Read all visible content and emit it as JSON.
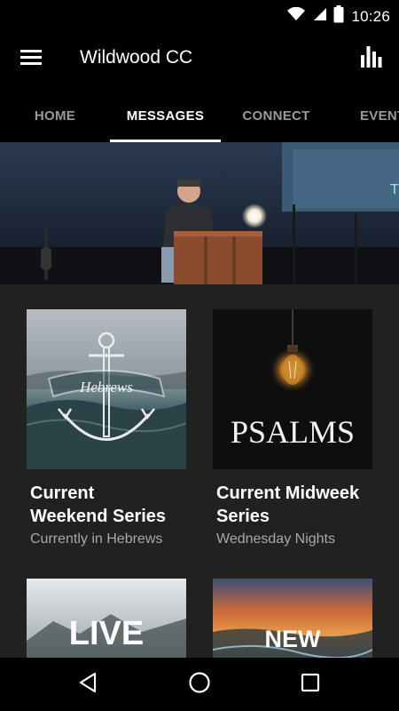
{
  "status_bar": {
    "time": "10:26"
  },
  "app_bar": {
    "title": "Wildwood CC"
  },
  "tabs": [
    {
      "label": "HOME"
    },
    {
      "label": "MESSAGES",
      "active": true
    },
    {
      "label": "CONNECT"
    },
    {
      "label": "EVENTS"
    }
  ],
  "hero": {
    "screen_text": "T"
  },
  "cards": [
    {
      "title_line1": "Current",
      "title_line2": "Weekend Series",
      "subtitle": "Currently in Hebrews",
      "thumb_text": "Hebrews"
    },
    {
      "title_line1": "Current Midweek",
      "title_line2": "Series",
      "subtitle": "Wednesday Nights",
      "thumb_text": "PSALMS"
    },
    {
      "thumb_text": "LIVE"
    },
    {
      "thumb_text": "NEW"
    }
  ],
  "colors": {
    "background": "#000000",
    "content_bg": "#212121",
    "tab_inactive": "#9a9a9a",
    "subtitle": "#a8a8a8"
  },
  "icons": [
    "wifi-icon",
    "signal-icon",
    "battery-icon",
    "menu-icon",
    "bar-chart-icon",
    "back-icon",
    "home-icon",
    "recents-icon"
  ]
}
